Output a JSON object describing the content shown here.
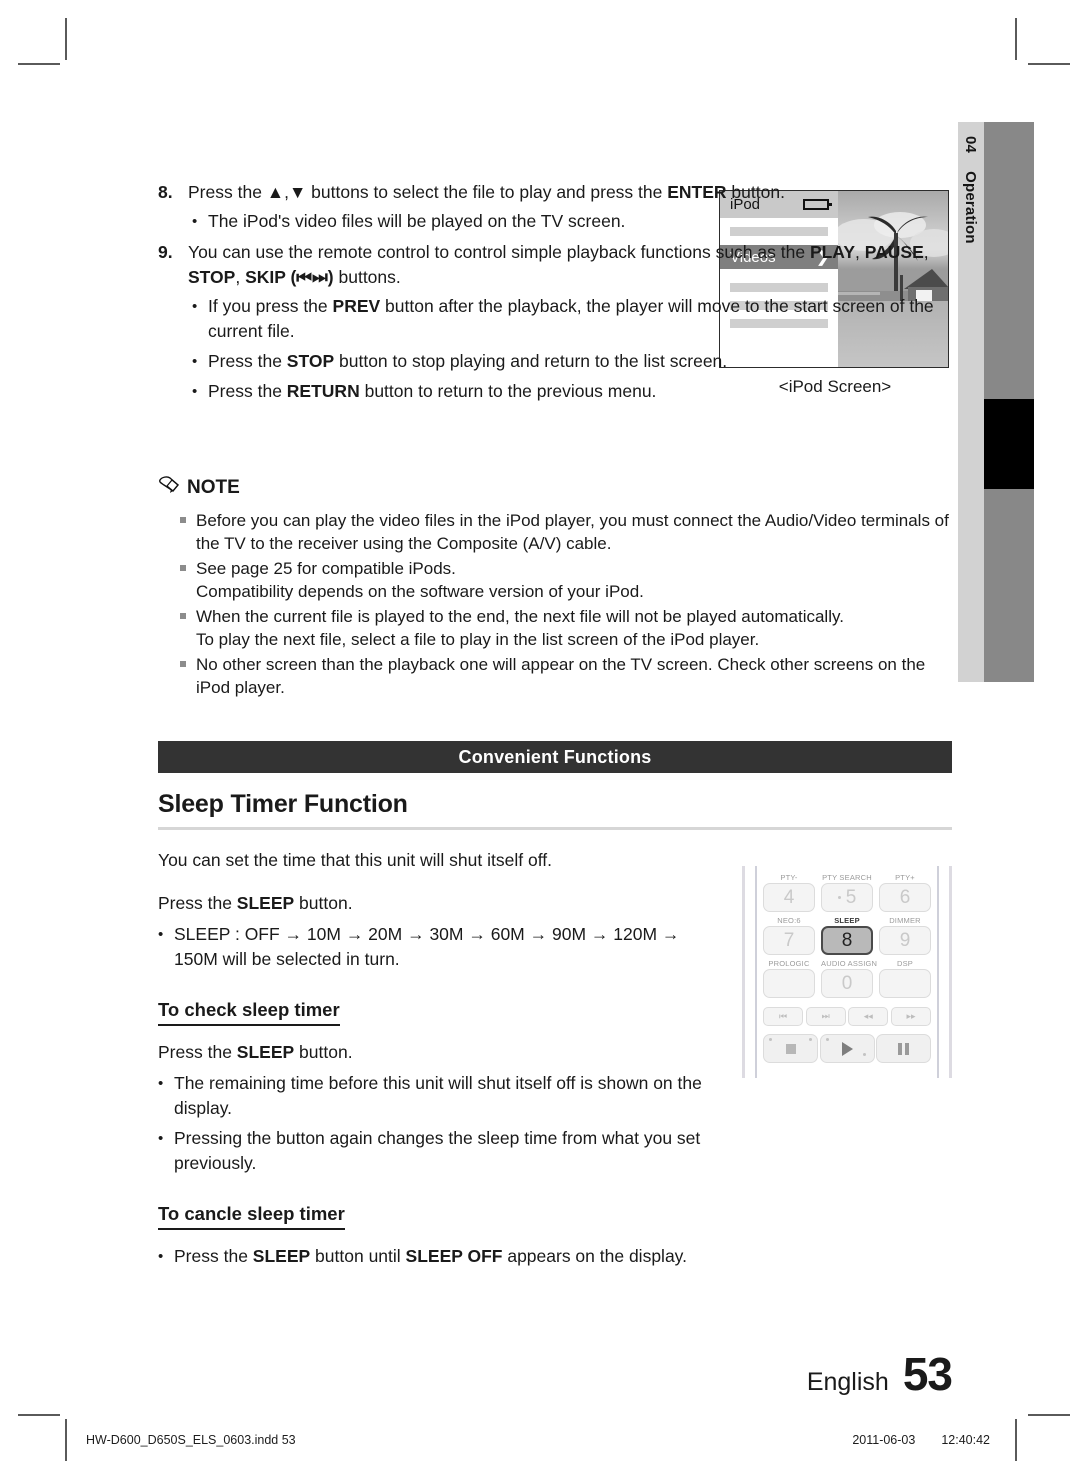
{
  "crop_marks": [
    "top-left",
    "top-right",
    "bottom-left",
    "bottom-right"
  ],
  "side_tab": {
    "chapter_number": "04",
    "chapter_name": "Operation"
  },
  "steps": [
    {
      "number": "8.",
      "text_parts": [
        {
          "t": "Press the ",
          "b": false
        },
        {
          "t": "▲,▼",
          "b": false
        },
        {
          "t": " buttons to select the file to play and press the ",
          "b": false
        },
        {
          "t": "ENTER",
          "b": true
        },
        {
          "t": " button.",
          "b": false
        }
      ],
      "bullets": [
        [
          {
            "t": "The iPod's video files will be played on the TV screen.",
            "b": false
          }
        ]
      ]
    },
    {
      "number": "9.",
      "text_parts": [
        {
          "t": "You can use the remote control to control simple playback functions such as the ",
          "b": false
        },
        {
          "t": "PLAY",
          "b": true
        },
        {
          "t": ", ",
          "b": false
        },
        {
          "t": "PAUSE",
          "b": true
        },
        {
          "t": ", ",
          "b": false
        },
        {
          "t": "STOP",
          "b": true
        },
        {
          "t": ", ",
          "b": false
        },
        {
          "t": "SKIP (⏮⏭)",
          "b": true
        },
        {
          "t": " buttons.",
          "b": false
        }
      ],
      "bullets": [
        [
          {
            "t": "If you press the ",
            "b": false
          },
          {
            "t": "PREV",
            "b": true
          },
          {
            "t": " button after the playback, the player will move to the start screen of the current file.",
            "b": false
          }
        ],
        [
          {
            "t": "Press the ",
            "b": false
          },
          {
            "t": "STOP",
            "b": true
          },
          {
            "t": " button to stop playing and return to the list screen.",
            "b": false
          }
        ],
        [
          {
            "t": "Press the ",
            "b": false
          },
          {
            "t": "RETURN",
            "b": true
          },
          {
            "t": " button to return to the previous menu.",
            "b": false
          }
        ]
      ]
    }
  ],
  "ipod_figure": {
    "title": "iPod",
    "battery_icon": "battery-icon",
    "selected_item": "Videos",
    "chevron": "❯",
    "blank_rows": 4,
    "caption": "<iPod Screen>"
  },
  "note": {
    "icon": "pencil-icon",
    "heading": "NOTE",
    "items": [
      "Before you can play the video files in the iPod player, you must connect the Audio/Video terminals of the TV to the receiver using the Composite (A/V) cable.",
      "See page 25 for compatible iPods.\nCompatibility depends on the software version of your iPod.",
      "When the current file is played to the end, the next file will not be played automatically.\nTo play the next file, select a file to play in the list screen of the iPod player.",
      "No other screen than the playback one will appear on the TV screen. Check other screens on the iPod player."
    ]
  },
  "section_bar": {
    "title": "Convenient Functions"
  },
  "sleep_timer": {
    "title": "Sleep Timer Function",
    "intro": "You can set the time that this unit will shut itself off.",
    "press_line": [
      {
        "t": "Press the ",
        "b": false
      },
      {
        "t": "SLEEP",
        "b": true
      },
      {
        "t": " button.",
        "b": false
      }
    ],
    "sequence_bullet": "SLEEP : OFF → 10M → 20M → 30M → 60M → 90M → 120M → 150M will be selected in turn.",
    "sequence_values": [
      "OFF",
      "10M",
      "20M",
      "30M",
      "60M",
      "90M",
      "120M",
      "150M"
    ],
    "check_heading": "To check sleep timer",
    "check_press_line": [
      {
        "t": "Press the ",
        "b": false
      },
      {
        "t": "SLEEP",
        "b": true
      },
      {
        "t": " button.",
        "b": false
      }
    ],
    "check_bullets": [
      [
        {
          "t": "The remaining time before this unit will shut itself off is shown on the display.",
          "b": false
        }
      ],
      [
        {
          "t": "Pressing the button again changes the sleep time from what you set previously.",
          "b": false
        }
      ]
    ],
    "cancel_heading": "To cancle sleep timer",
    "cancel_bullets": [
      [
        {
          "t": "Press the ",
          "b": false
        },
        {
          "t": "SLEEP",
          "b": true
        },
        {
          "t": " button until ",
          "b": false
        },
        {
          "t": "SLEEP OFF",
          "b": true
        },
        {
          "t": " appears on the display.",
          "b": false
        }
      ]
    ]
  },
  "remote": {
    "rows": [
      [
        {
          "label": "PTY-",
          "key": "4",
          "selected": false,
          "dot": false
        },
        {
          "label": "PTY SEARCH",
          "key": "5",
          "selected": false,
          "dot": true
        },
        {
          "label": "PTY+",
          "key": "6",
          "selected": false,
          "dot": false
        }
      ],
      [
        {
          "label": "NEO:6",
          "key": "7",
          "selected": false,
          "dot": false
        },
        {
          "label": "SLEEP",
          "key": "8",
          "selected": true,
          "dot": false
        },
        {
          "label": "DIMMER",
          "key": "9",
          "selected": false,
          "dot": false
        }
      ],
      [
        {
          "label": "PROLOGIC",
          "key": "",
          "selected": false,
          "dot": false
        },
        {
          "label": "AUDIO ASSIGN",
          "key": "0",
          "selected": false,
          "dot": false
        },
        {
          "label": "DSP",
          "key": "",
          "selected": false,
          "dot": false
        }
      ]
    ],
    "transport": [
      "⏮",
      "⏭",
      "◂◂",
      "▸▸"
    ],
    "playback": [
      "stop-icon",
      "play-icon",
      "pause-icon"
    ]
  },
  "footer": {
    "english_label": "English",
    "page_number": "53",
    "file_name": "HW-D600_D650S_ELS_0603.indd   53",
    "date": "2011-06-03",
    "time": "12:40:42"
  }
}
